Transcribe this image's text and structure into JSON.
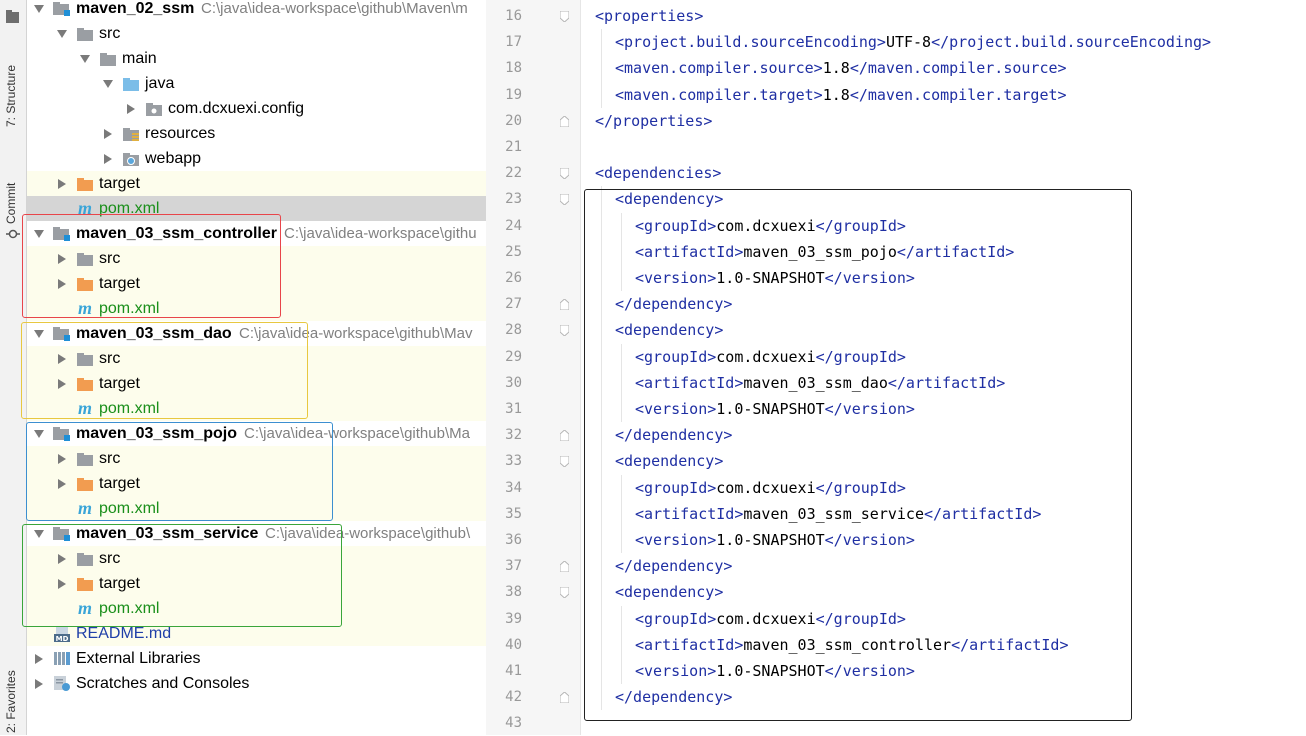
{
  "sidebar": {
    "structure_label": "7: Structure",
    "commit_label": "Commit",
    "favorites_label": "2: Favorites"
  },
  "tree": {
    "rows": [
      {
        "label": "maven_02_ssm",
        "path": "C:\\java\\idea-workspace\\github\\Maven\\m",
        "bold": true,
        "icon": "module-folder-icon",
        "arrow": "down",
        "indent": 0
      },
      {
        "label": "src",
        "path": "",
        "bold": false,
        "icon": "folder-icon",
        "arrow": "down",
        "indent": 1
      },
      {
        "label": "main",
        "path": "",
        "bold": false,
        "icon": "folder-icon",
        "arrow": "down",
        "indent": 2
      },
      {
        "label": "java",
        "path": "",
        "bold": false,
        "icon": "source-folder-icon",
        "arrow": "down",
        "indent": 3
      },
      {
        "label": "com.dcxuexi.config",
        "path": "",
        "bold": false,
        "icon": "package-icon",
        "arrow": "right",
        "indent": 4
      },
      {
        "label": "resources",
        "path": "",
        "bold": false,
        "icon": "resources-folder-icon",
        "arrow": "right",
        "indent": 3
      },
      {
        "label": "webapp",
        "path": "",
        "bold": false,
        "icon": "web-folder-icon",
        "arrow": "right",
        "indent": 3
      },
      {
        "label": "target",
        "path": "",
        "bold": false,
        "icon": "target-folder-icon",
        "arrow": "right",
        "indent": 1
      },
      {
        "label": "pom.xml",
        "path": "",
        "bold": false,
        "icon": "maven-icon",
        "arrow": "none",
        "indent": 1
      },
      {
        "label": "maven_03_ssm_controller",
        "path": "C:\\java\\idea-workspace\\githu",
        "bold": true,
        "icon": "module-folder-icon",
        "arrow": "down",
        "indent": 0
      },
      {
        "label": "src",
        "path": "",
        "bold": false,
        "icon": "folder-icon",
        "arrow": "right",
        "indent": 1
      },
      {
        "label": "target",
        "path": "",
        "bold": false,
        "icon": "target-folder-icon",
        "arrow": "right",
        "indent": 1
      },
      {
        "label": "pom.xml",
        "path": "",
        "bold": false,
        "icon": "maven-icon",
        "arrow": "none",
        "indent": 1
      },
      {
        "label": "maven_03_ssm_dao",
        "path": "C:\\java\\idea-workspace\\github\\Mav",
        "bold": true,
        "icon": "module-folder-icon",
        "arrow": "down",
        "indent": 0
      },
      {
        "label": "src",
        "path": "",
        "bold": false,
        "icon": "folder-icon",
        "arrow": "right",
        "indent": 1
      },
      {
        "label": "target",
        "path": "",
        "bold": false,
        "icon": "target-folder-icon",
        "arrow": "right",
        "indent": 1
      },
      {
        "label": "pom.xml",
        "path": "",
        "bold": false,
        "icon": "maven-icon",
        "arrow": "none",
        "indent": 1
      },
      {
        "label": "maven_03_ssm_pojo",
        "path": "C:\\java\\idea-workspace\\github\\Ma",
        "bold": true,
        "icon": "module-folder-icon",
        "arrow": "down",
        "indent": 0
      },
      {
        "label": "src",
        "path": "",
        "bold": false,
        "icon": "folder-icon",
        "arrow": "right",
        "indent": 1
      },
      {
        "label": "target",
        "path": "",
        "bold": false,
        "icon": "target-folder-icon",
        "arrow": "right",
        "indent": 1
      },
      {
        "label": "pom.xml",
        "path": "",
        "bold": false,
        "icon": "maven-icon",
        "arrow": "none",
        "indent": 1
      },
      {
        "label": "maven_03_ssm_service",
        "path": "C:\\java\\idea-workspace\\github\\",
        "bold": true,
        "icon": "module-folder-icon",
        "arrow": "down",
        "indent": 0
      },
      {
        "label": "src",
        "path": "",
        "bold": false,
        "icon": "folder-icon",
        "arrow": "right",
        "indent": 1
      },
      {
        "label": "target",
        "path": "",
        "bold": false,
        "icon": "target-folder-icon",
        "arrow": "right",
        "indent": 1
      },
      {
        "label": "pom.xml",
        "path": "",
        "bold": false,
        "icon": "maven-icon",
        "arrow": "none",
        "indent": 1
      },
      {
        "label": "README.md",
        "path": "",
        "bold": false,
        "icon": "markdown-icon",
        "arrow": "none",
        "indent": 0
      },
      {
        "label": "External Libraries",
        "path": "",
        "bold": false,
        "icon": "libraries-icon",
        "arrow": "right",
        "indent": 0
      },
      {
        "label": "Scratches and Consoles",
        "path": "",
        "bold": false,
        "icon": "scratches-icon",
        "arrow": "right",
        "indent": 0
      }
    ]
  },
  "editor": {
    "lines": [
      {
        "num": "16",
        "indent": 0,
        "parts": [
          [
            "t",
            "<properties>"
          ]
        ]
      },
      {
        "num": "17",
        "indent": 1,
        "parts": [
          [
            "t",
            "<project.build.sourceEncoding>"
          ],
          [
            "x",
            "UTF-8"
          ],
          [
            "t",
            "</project.build.sourceEncoding>"
          ]
        ]
      },
      {
        "num": "18",
        "indent": 1,
        "parts": [
          [
            "t",
            "<maven.compiler.source>"
          ],
          [
            "x",
            "1.8"
          ],
          [
            "t",
            "</maven.compiler.source>"
          ]
        ]
      },
      {
        "num": "19",
        "indent": 1,
        "parts": [
          [
            "t",
            "<maven.compiler.target>"
          ],
          [
            "x",
            "1.8"
          ],
          [
            "t",
            "</maven.compiler.target>"
          ]
        ]
      },
      {
        "num": "20",
        "indent": 0,
        "parts": [
          [
            "t",
            "</properties>"
          ]
        ]
      },
      {
        "num": "21",
        "indent": 0,
        "parts": []
      },
      {
        "num": "22",
        "indent": 0,
        "parts": [
          [
            "t",
            "<dependencies>"
          ]
        ]
      },
      {
        "num": "23",
        "indent": 1,
        "parts": [
          [
            "t",
            "<dependency>"
          ]
        ]
      },
      {
        "num": "24",
        "indent": 2,
        "parts": [
          [
            "t",
            "<groupId>"
          ],
          [
            "x",
            "com.dcxuexi"
          ],
          [
            "t",
            "</groupId>"
          ]
        ]
      },
      {
        "num": "25",
        "indent": 2,
        "parts": [
          [
            "t",
            "<artifactId>"
          ],
          [
            "x",
            "maven_03_ssm_pojo"
          ],
          [
            "t",
            "</artifactId>"
          ]
        ]
      },
      {
        "num": "26",
        "indent": 2,
        "parts": [
          [
            "t",
            "<version>"
          ],
          [
            "x",
            "1.0-SNAPSHOT"
          ],
          [
            "t",
            "</version>"
          ]
        ]
      },
      {
        "num": "27",
        "indent": 1,
        "parts": [
          [
            "t",
            "</dependency>"
          ]
        ]
      },
      {
        "num": "28",
        "indent": 1,
        "parts": [
          [
            "t",
            "<dependency>"
          ]
        ]
      },
      {
        "num": "29",
        "indent": 2,
        "parts": [
          [
            "t",
            "<groupId>"
          ],
          [
            "x",
            "com.dcxuexi"
          ],
          [
            "t",
            "</groupId>"
          ]
        ]
      },
      {
        "num": "30",
        "indent": 2,
        "parts": [
          [
            "t",
            "<artifactId>"
          ],
          [
            "x",
            "maven_03_ssm_dao"
          ],
          [
            "t",
            "</artifactId>"
          ]
        ]
      },
      {
        "num": "31",
        "indent": 2,
        "parts": [
          [
            "t",
            "<version>"
          ],
          [
            "x",
            "1.0-SNAPSHOT"
          ],
          [
            "t",
            "</version>"
          ]
        ]
      },
      {
        "num": "32",
        "indent": 1,
        "parts": [
          [
            "t",
            "</dependency>"
          ]
        ]
      },
      {
        "num": "33",
        "indent": 1,
        "parts": [
          [
            "t",
            "<dependency>"
          ]
        ]
      },
      {
        "num": "34",
        "indent": 2,
        "parts": [
          [
            "t",
            "<groupId>"
          ],
          [
            "x",
            "com.dcxuexi"
          ],
          [
            "t",
            "</groupId>"
          ]
        ]
      },
      {
        "num": "35",
        "indent": 2,
        "parts": [
          [
            "t",
            "<artifactId>"
          ],
          [
            "x",
            "maven_03_ssm_service"
          ],
          [
            "t",
            "</artifactId>"
          ]
        ]
      },
      {
        "num": "36",
        "indent": 2,
        "parts": [
          [
            "t",
            "<version>"
          ],
          [
            "x",
            "1.0-SNAPSHOT"
          ],
          [
            "t",
            "</version>"
          ]
        ]
      },
      {
        "num": "37",
        "indent": 1,
        "parts": [
          [
            "t",
            "</dependency>"
          ]
        ]
      },
      {
        "num": "38",
        "indent": 1,
        "parts": [
          [
            "t",
            "<dependency>"
          ]
        ]
      },
      {
        "num": "39",
        "indent": 2,
        "parts": [
          [
            "t",
            "<groupId>"
          ],
          [
            "x",
            "com.dcxuexi"
          ],
          [
            "t",
            "</groupId>"
          ]
        ]
      },
      {
        "num": "40",
        "indent": 2,
        "parts": [
          [
            "t",
            "<artifactId>"
          ],
          [
            "x",
            "maven_03_ssm_controller"
          ],
          [
            "t",
            "</artifactId>"
          ]
        ]
      },
      {
        "num": "41",
        "indent": 2,
        "parts": [
          [
            "t",
            "<version>"
          ],
          [
            "x",
            "1.0-SNAPSHOT"
          ],
          [
            "t",
            "</version>"
          ]
        ]
      },
      {
        "num": "42",
        "indent": 1,
        "parts": [
          [
            "t",
            "</dependency>"
          ]
        ]
      },
      {
        "num": "43",
        "indent": 0,
        "parts": []
      }
    ]
  },
  "colors": {
    "tag": "#1f2fa3",
    "controller_box": "#e8454a",
    "dao_box": "#e8c840",
    "pojo_box": "#3c8fd0",
    "service_box": "#3aa53a",
    "code_box": "#222222"
  }
}
